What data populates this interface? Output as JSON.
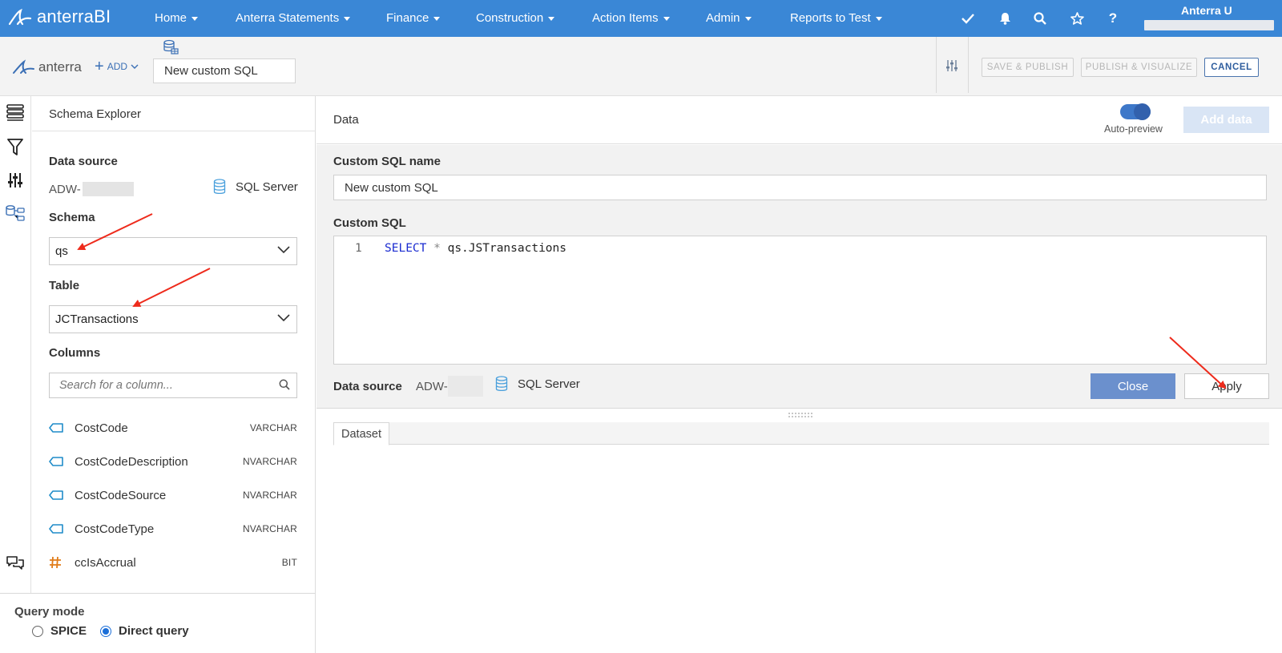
{
  "brand": {
    "name": "anterraBI"
  },
  "nav": {
    "items": [
      "Home",
      "Anterra Statements",
      "Finance",
      "Construction",
      "Action Items",
      "Admin",
      "Reports to Test"
    ],
    "user_name": "Anterra U"
  },
  "toolbar": {
    "logo_text": "anterra",
    "add_label": "ADD",
    "dataset_name": "New custom SQL",
    "save_publish": "SAVE & PUBLISH",
    "publish_visualize": "PUBLISH & VISUALIZE",
    "cancel": "CANCEL"
  },
  "schema_explorer": {
    "title": "Schema Explorer",
    "data_source_label": "Data source",
    "data_source_value": "ADW-",
    "data_source_type": "SQL Server",
    "schema_label": "Schema",
    "schema_value": "qs",
    "table_label": "Table",
    "table_value": "JCTransactions",
    "columns_label": "Columns",
    "search_placeholder": "Search for a column...",
    "columns": [
      {
        "name": "CostCode",
        "type": "VARCHAR",
        "icon": "string-tag-icon"
      },
      {
        "name": "CostCodeDescription",
        "type": "NVARCHAR",
        "icon": "string-tag-icon"
      },
      {
        "name": "CostCodeSource",
        "type": "NVARCHAR",
        "icon": "string-tag-icon"
      },
      {
        "name": "CostCodeType",
        "type": "NVARCHAR",
        "icon": "string-tag-icon"
      },
      {
        "name": "ccIsAccrual",
        "type": "BIT",
        "icon": "hash-icon"
      }
    ]
  },
  "query_mode": {
    "label": "Query mode",
    "options": [
      "SPICE",
      "Direct query"
    ],
    "selected": "Direct query"
  },
  "data_panel": {
    "title": "Data",
    "auto_preview_label": "Auto-preview",
    "auto_preview_on": true,
    "add_data": "Add data",
    "sql_name_label": "Custom SQL name",
    "sql_name_value": "New custom SQL",
    "sql_label": "Custom SQL",
    "line_number": "1",
    "sql_keyword": "SELECT",
    "sql_operator": "*",
    "sql_rest": "qs.JSTransactions",
    "data_source_label": "Data source",
    "data_source_value": "ADW-",
    "data_source_type": "SQL Server",
    "close": "Close",
    "apply": "Apply",
    "dataset_tab": "Dataset"
  },
  "colors": {
    "nav_bg": "#3a87d6",
    "accent": "#3261ad",
    "annotation_arrow": "#ee2b1c"
  }
}
